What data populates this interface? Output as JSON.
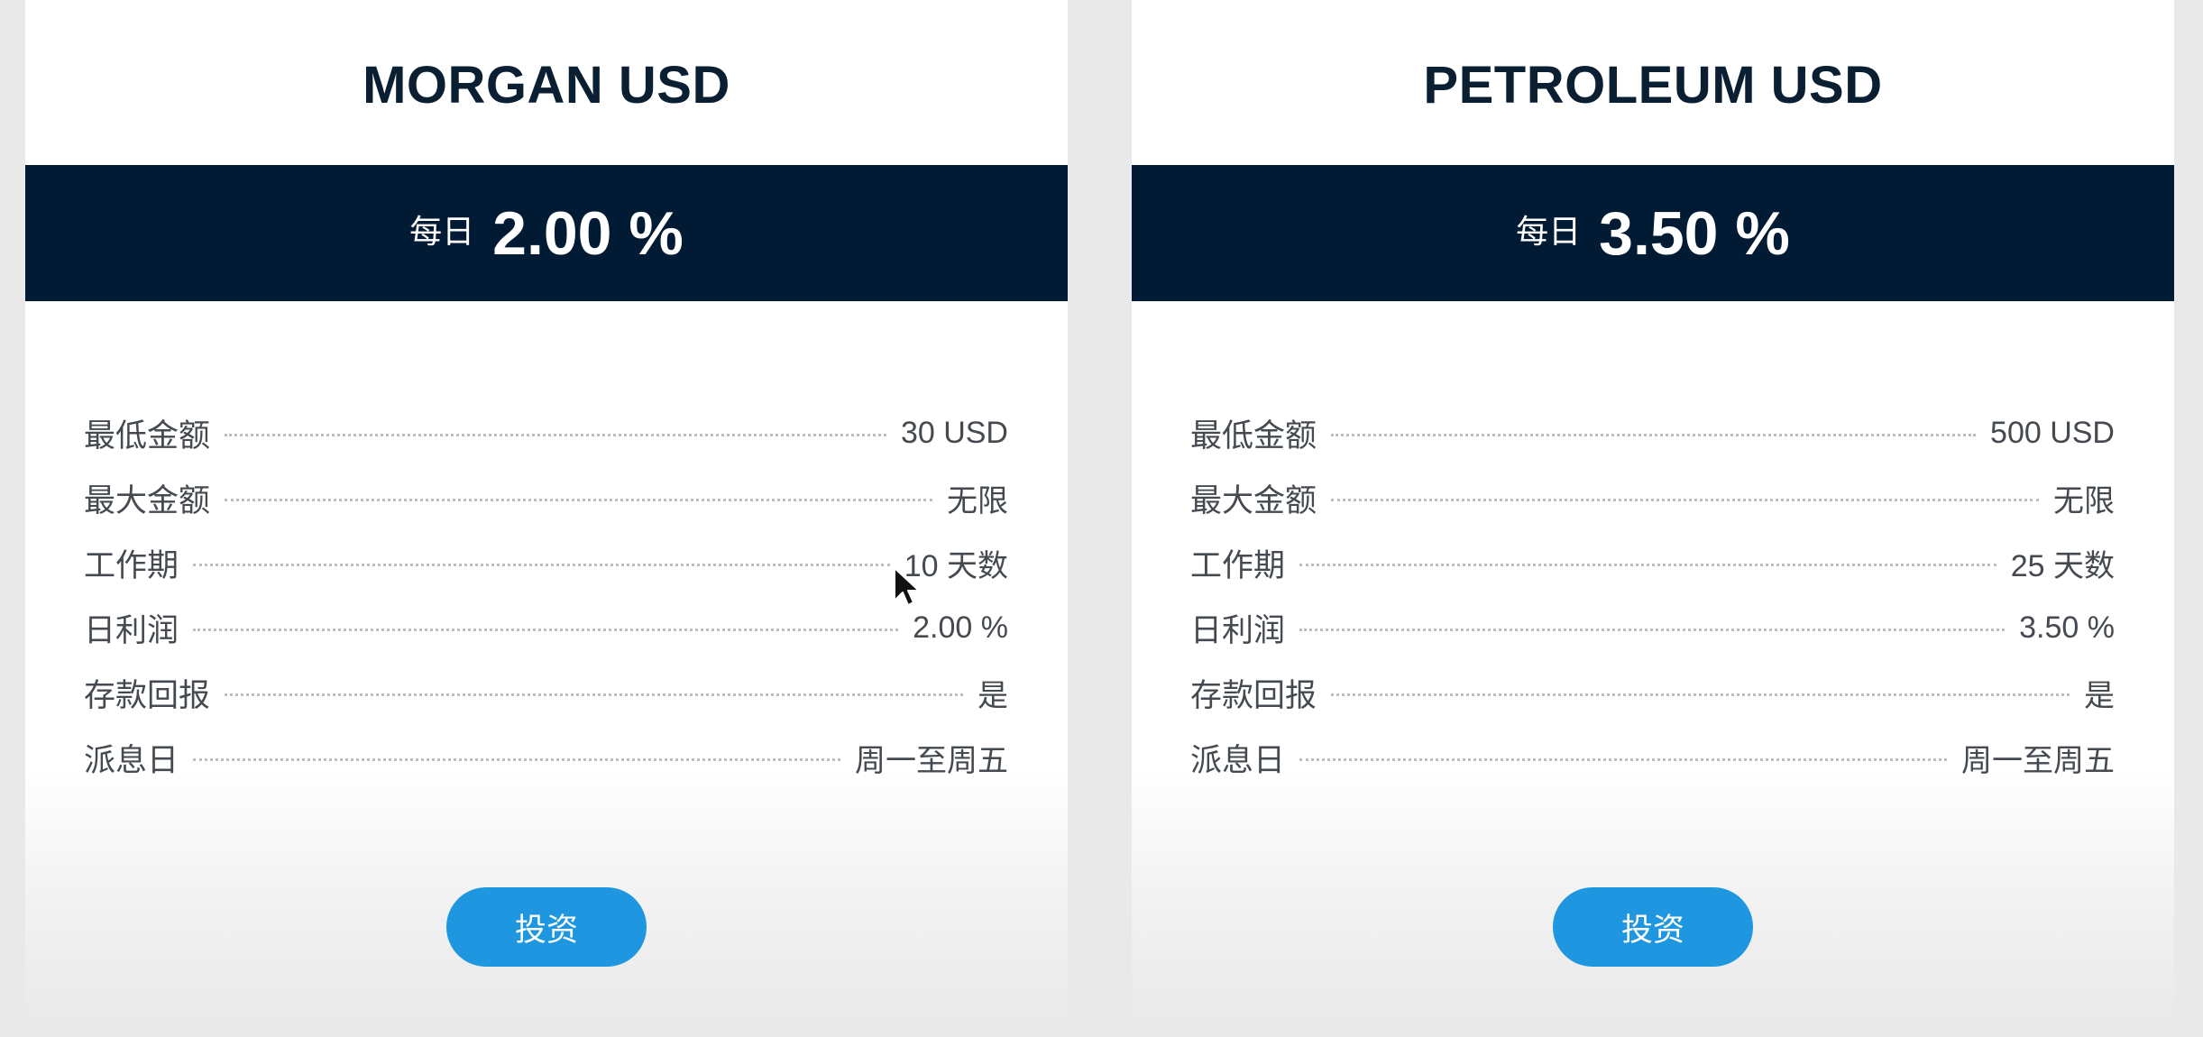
{
  "plans": [
    {
      "name": "MORGAN USD",
      "rate_prefix": "每日",
      "rate": "2.00 %",
      "details": [
        {
          "label": "最低金额",
          "value": "30 USD"
        },
        {
          "label": "最大金额",
          "value": "无限"
        },
        {
          "label": "工作期",
          "value": "10 天数"
        },
        {
          "label": "日利润",
          "value": "2.00 %"
        },
        {
          "label": "存款回报",
          "value": "是"
        },
        {
          "label": "派息日",
          "value": "周一至周五"
        }
      ],
      "button_label": "投资"
    },
    {
      "name": "PETROLEUM USD",
      "rate_prefix": "每日",
      "rate": "3.50 %",
      "details": [
        {
          "label": "最低金额",
          "value": "500 USD"
        },
        {
          "label": "最大金额",
          "value": "无限"
        },
        {
          "label": "工作期",
          "value": "25 天数"
        },
        {
          "label": "日利润",
          "value": "3.50 %"
        },
        {
          "label": "存款回报",
          "value": "是"
        },
        {
          "label": "派息日",
          "value": "周一至周五"
        }
      ],
      "button_label": "投资"
    }
  ],
  "colors": {
    "rate_bar": "#011b34",
    "button": "#1e96e0",
    "title": "#0b1f33"
  },
  "icons": {
    "cursor": "mouse-pointer-icon"
  }
}
